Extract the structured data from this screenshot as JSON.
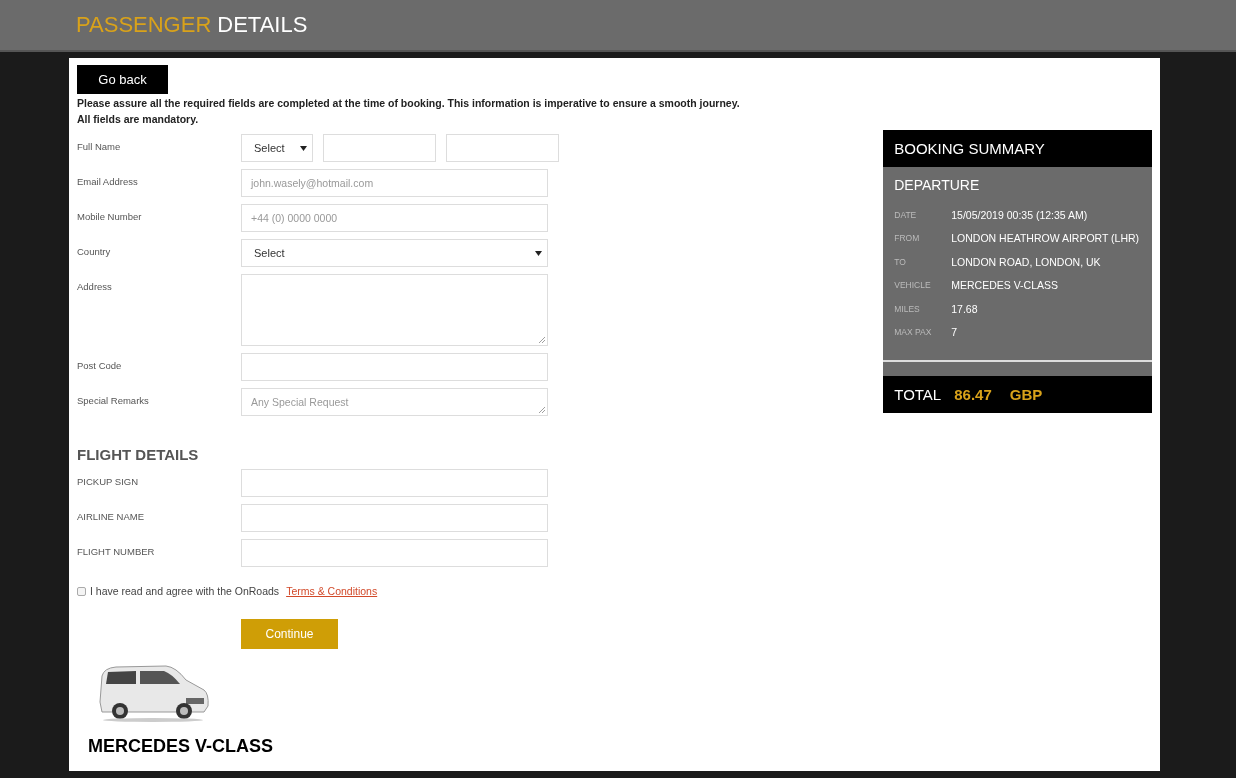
{
  "header": {
    "title_highlight": "PASSENGER",
    "title": "DETAILS"
  },
  "back_button": "Go back",
  "notice": [
    "Please assure all the required fields are completed at the time of booking. This information is imperative to ensure a smooth journey.",
    "All fields are mandatory."
  ],
  "passenger_fields": [
    {
      "kind": "name",
      "label": "Full Name",
      "select": "Select"
    },
    {
      "kind": "text",
      "label": "Email Address",
      "placeholder": "john.wasely@hotmail.com"
    },
    {
      "kind": "text",
      "label": "Mobile Number",
      "placeholder": "+44 (0) 0000 0000"
    },
    {
      "kind": "select",
      "label": "Country",
      "select": "Select"
    },
    {
      "kind": "textarea",
      "label": "Address"
    },
    {
      "kind": "text",
      "label": "Post Code"
    },
    {
      "kind": "remarks",
      "label": "Special Remarks",
      "placeholder": "Any Special Request"
    }
  ],
  "flight_heading": "FLIGHT DETAILS",
  "flight_fields": [
    {
      "kind": "text",
      "label": "PICKUP SIGN"
    },
    {
      "kind": "text",
      "label": "AIRLINE NAME"
    },
    {
      "kind": "text",
      "label": "FLIGHT NUMBER"
    }
  ],
  "agreement": {
    "checked": false,
    "text": "I have read and agree with the OnRoads",
    "link": "Terms & Conditions"
  },
  "continue_button": "Continue",
  "vehicle": {
    "kind": "picture",
    "name": "MERCEDES V-CLASS"
  },
  "summary": {
    "title": "BOOKING SUMMARY",
    "section": "DEPARTURE",
    "rows": [
      {
        "label": "DATE",
        "value": "15/05/2019 00:35 (12:35 AM)"
      },
      {
        "label": "FROM",
        "value": "LONDON HEATHROW AIRPORT (LHR)"
      },
      {
        "label": "TO",
        "value": "LONDON ROAD, LONDON, UK"
      },
      {
        "label": "VEHICLE",
        "value": "MERCEDES V-CLASS"
      },
      {
        "label": "MILES",
        "value": "17.68"
      },
      {
        "label": "MAX PAX",
        "value": "7"
      }
    ],
    "total_label": "TOTAL",
    "total_amount": "86.47",
    "currency": "GBP"
  }
}
